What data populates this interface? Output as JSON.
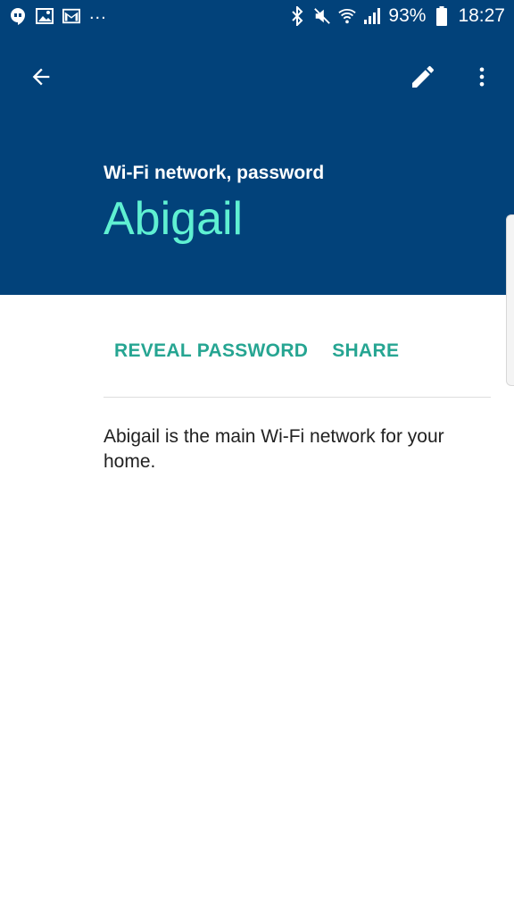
{
  "status_bar": {
    "icons_left": [
      "hangouts-icon",
      "image-icon",
      "gmail-icon"
    ],
    "overflow": "...",
    "battery_percent": "93%",
    "time": "18:27"
  },
  "app_bar": {
    "subtitle": "Wi-Fi network, password",
    "title": "Abigail"
  },
  "actions": {
    "reveal_password": "REVEAL PASSWORD",
    "share": "SHARE"
  },
  "description": "Abigail is the main Wi-Fi network for your home.",
  "colors": {
    "header_bg": "#02427a",
    "title_accent": "#5ff0d2",
    "action_accent": "#26a592"
  }
}
